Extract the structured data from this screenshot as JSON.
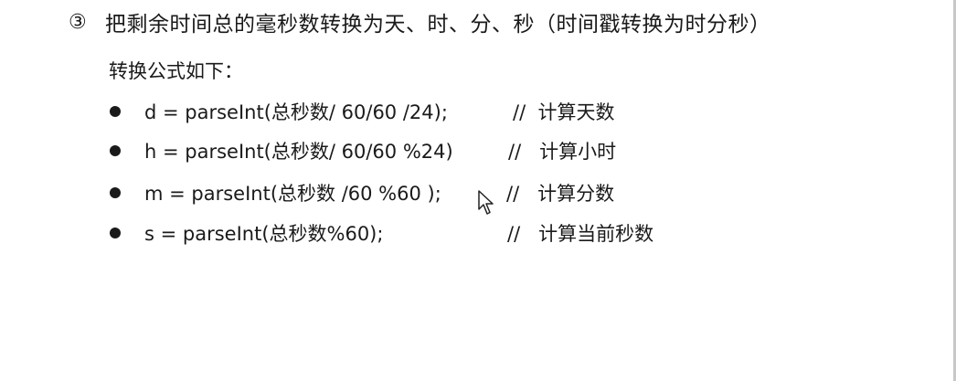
{
  "heading": {
    "number": "③",
    "text": "把剩余时间总的毫秒数转换为天、时、分、秒（时间戳转换为时分秒）"
  },
  "intro": "转换公式如下：",
  "formulas": [
    {
      "code": "d = parseInt(总秒数/ 60/60 /24);",
      "comment": "//  计算天数"
    },
    {
      "code": "h = parseInt(总秒数/ 60/60 %24)",
      "comment": "//   计算小时"
    },
    {
      "code": "m = parseInt(总秒数 /60 %60 );",
      "comment": "//   计算分数"
    },
    {
      "code": "s = parseInt(总秒数%60);",
      "comment": "//   计算当前秒数"
    }
  ],
  "icons": {
    "bullet": "bullet-dot-icon",
    "cursor": "mouse-pointer-icon"
  }
}
